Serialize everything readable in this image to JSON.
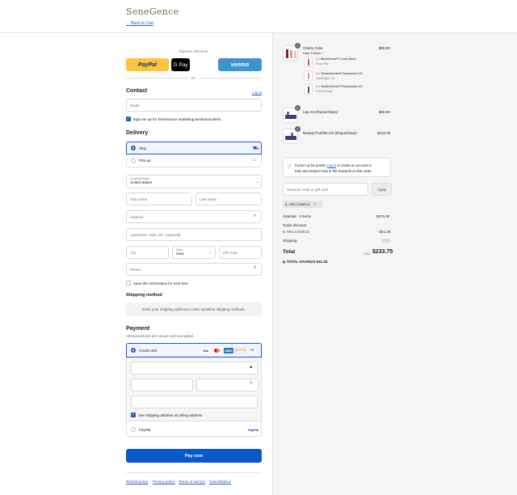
{
  "header": {
    "logo_text": "SeneGence",
    "back_link": "← Back to Cart"
  },
  "express": {
    "label": "Express checkout",
    "paypal": "PayPal",
    "gpay": "G Pay",
    "venmo": "venmo",
    "or": "OR"
  },
  "contact": {
    "title": "Contact",
    "login": "Log in",
    "email_placeholder": "Email",
    "marketing_label": "Sign me up for SeneGence marketing text/email alerts."
  },
  "delivery": {
    "title": "Delivery",
    "ship": "Ship",
    "pickup": "Pick up",
    "country_label": "Country/Region",
    "country_value": "United States",
    "first_name": "First name",
    "last_name": "Last name",
    "address": "Address",
    "apartment": "Apartment, suite, etc. (optional)",
    "city": "City",
    "state_label": "State",
    "state_value": "Iowa",
    "zip": "ZIP code",
    "phone": "Phone",
    "save_info": "Save this information for next time"
  },
  "shipping_method": {
    "title": "Shipping method",
    "message": "Enter your shipping address to view available shipping methods."
  },
  "payment": {
    "title": "Payment",
    "subtitle": "All transactions are secure and encrypted.",
    "credit_card": "Credit card",
    "cards": [
      "VISA",
      "MC",
      "AMEX",
      "DISCOVER"
    ],
    "more_cards": "+3",
    "billing_same": "Use shipping address as billing address",
    "paypal_option": "PayPal",
    "paypal_logo": "PayPal",
    "pay_now": "Pay now"
  },
  "footer": {
    "links": [
      "Refund policy",
      "Privacy policy",
      "Terms of service",
      "Cancellations"
    ]
  },
  "order": {
    "items": [
      {
        "qty": "1",
        "name": "Cherry Cola",
        "price": "$85.00",
        "toggle": "Hide 3 items",
        "sub": [
          {
            "name": "1 × BlushSense® Cream Blush",
            "variant": "Pouty Pink"
          },
          {
            "name": "1 × ShadowSense® Eyeshadow US",
            "variant": "Candlelight, US"
          },
          {
            "name": "1 × ShadowSense® Eyeshadow US",
            "variant": "French Roast"
          }
        ]
      },
      {
        "qty": "1",
        "name": "Lips Kit (Repurchase)",
        "price": "$65.00"
      },
      {
        "qty": "1",
        "name": "Beauty Portfolio Kit (Repurchase)",
        "price": "$125.00"
      }
    ],
    "rewards_prefix": "Pucker up for points!",
    "rewards_login": "Log in",
    "rewards_rest": "or create an account to",
    "rewards_line2": "earn and redeem Kiss & Tell Rewards on this order.",
    "discount_placeholder": "Discount code or gift card",
    "apply": "Apply",
    "discount_tag": "WELCOME15",
    "subtotal_label": "Subtotal · 3 items",
    "subtotal_value": "$275.00",
    "order_discount_label": "Order discount",
    "discount_code": "WELCOME15",
    "discount_value": "- $41.25",
    "shipping_label": "Shipping",
    "total_label": "Total",
    "currency": "USD",
    "total_value": "$233.75",
    "savings_label": "TOTAL SAVINGS",
    "savings_value": "$41.25"
  },
  "colors": {
    "accent": "#1f58c7",
    "paypal": "#ffc439",
    "venmo": "#3d95ce",
    "pay_button": "#0a58c9"
  }
}
